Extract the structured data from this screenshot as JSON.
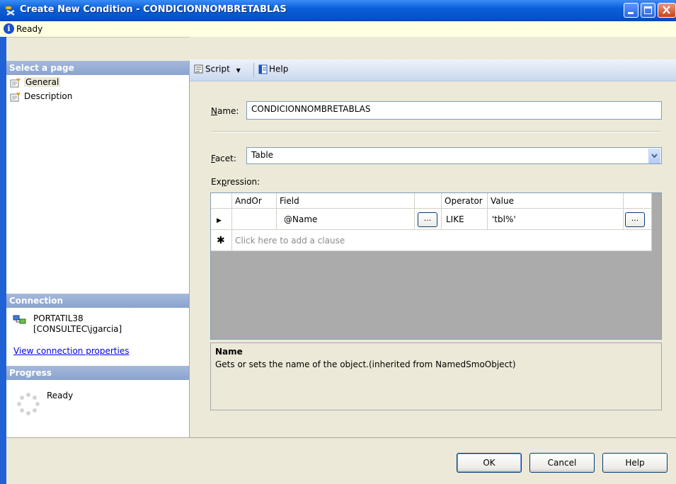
{
  "window": {
    "title": "Create New Condition - CONDICIONNOMBRETABLAS"
  },
  "status": {
    "text": "Ready"
  },
  "sidebar": {
    "select_page_header": "Select a page",
    "pages": [
      {
        "label": "General",
        "selected": true
      },
      {
        "label": "Description",
        "selected": false
      }
    ],
    "connection_header": "Connection",
    "connection_server": "PORTATIL38",
    "connection_user": "[CONSULTEC\\jgarcia]",
    "connection_link": "View connection properties",
    "progress_header": "Progress",
    "progress_text": "Ready"
  },
  "toolbar": {
    "script_label": "Script",
    "help_label": "Help"
  },
  "form": {
    "name_label_u": "N",
    "name_label_rest": "ame:",
    "name_value": "CONDICIONNOMBRETABLAS",
    "facet_label_u": "F",
    "facet_label_rest": "acet:",
    "facet_value": "Table",
    "expression_label_pre": "Ex",
    "expression_label_u": "p",
    "expression_label_rest": "ression:"
  },
  "grid": {
    "headers": {
      "andor": "AndOr",
      "field": "Field",
      "operator": "Operator",
      "value": "Value"
    },
    "rows": [
      {
        "andor": "",
        "field": "@Name",
        "operator": "LIKE",
        "value": "'tbl%'"
      }
    ],
    "new_row_text": "Click here to add a clause",
    "ellipsis": "..."
  },
  "description": {
    "title": "Name",
    "text": "Gets or sets the name of the object.(inherited from NamedSmoObject)"
  },
  "buttons": {
    "ok": "OK",
    "cancel": "Cancel",
    "help": "Help"
  },
  "colors": {
    "titlebar": "#0a5fd8",
    "status_bg": "#ffffe1",
    "section_header": "#8aa3cf",
    "dialog_bg": "#ece9d8"
  }
}
